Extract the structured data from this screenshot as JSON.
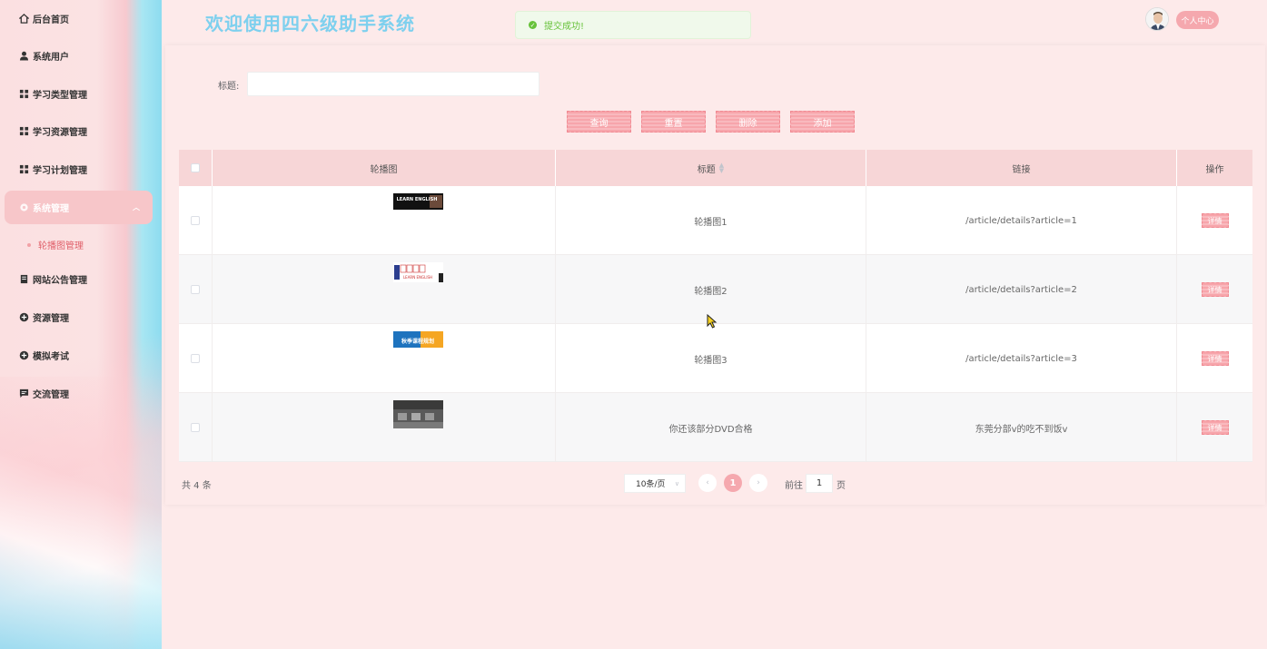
{
  "sidebar": {
    "items": [
      {
        "label": "后台首页",
        "icon": "home-icon"
      },
      {
        "label": "系统用户",
        "icon": "user-icon"
      },
      {
        "label": "学习类型管理",
        "icon": "grid-icon"
      },
      {
        "label": "学习资源管理",
        "icon": "grid-icon"
      },
      {
        "label": "学习计划管理",
        "icon": "grid-icon"
      },
      {
        "label": "系统管理",
        "icon": "gear-icon"
      },
      {
        "label": "网站公告管理",
        "icon": "notice-icon"
      },
      {
        "label": "资源管理",
        "icon": "plus-circle-icon"
      },
      {
        "label": "模拟考试",
        "icon": "plus-circle-icon"
      },
      {
        "label": "交流管理",
        "icon": "chat-icon"
      }
    ],
    "submenu": {
      "label": "轮播图管理"
    }
  },
  "header": {
    "title": "欢迎使用四六级助手系统",
    "user_center": "个人中心"
  },
  "toast": {
    "message": "提交成功!"
  },
  "search": {
    "label": "标题:",
    "value": ""
  },
  "toolbar": {
    "query_label": "查询",
    "reset_label": "重置",
    "delete_label": "删除",
    "add_label": "添加"
  },
  "table": {
    "headers": {
      "image": "轮播图",
      "title": "标题",
      "link": "链接",
      "action": "操作"
    },
    "rows": [
      {
        "title": "轮播图1",
        "link": "/article/details?article=1",
        "action": "详情",
        "thumb_text": "LEARN ENGLISH"
      },
      {
        "title": "轮播图2",
        "link": "/article/details?article=2",
        "action": "详情",
        "thumb_text": "LEARN ENGLISH"
      },
      {
        "title": "轮播图3",
        "link": "/article/details?article=3",
        "action": "详情",
        "thumb_text": "秋季课程规划"
      },
      {
        "title": "你还该部分DVD合格",
        "link": "东莞分部v的吃不到饭v",
        "action": "详情",
        "thumb_text": ""
      }
    ]
  },
  "pagination": {
    "total": "共 4 条",
    "page_size": "10条/页",
    "current_page": "1",
    "goto_label": "前往",
    "goto_value": "1",
    "page_unit": "页"
  },
  "colors": {
    "accent": "#f5a8ae",
    "title": "#7ed0ee",
    "success": "#67c23a"
  }
}
